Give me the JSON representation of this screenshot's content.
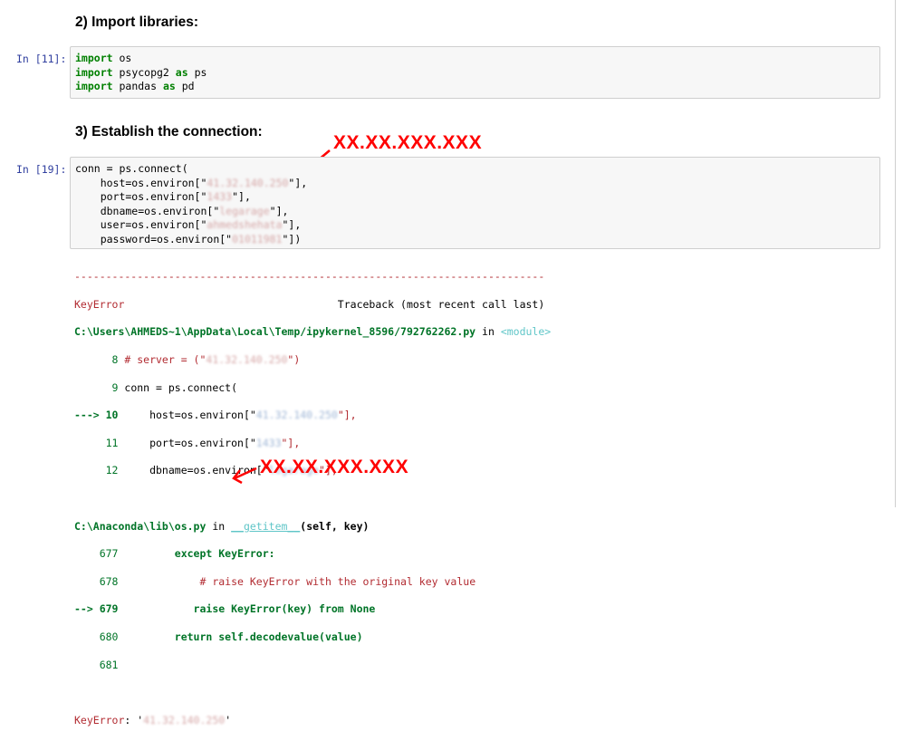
{
  "headings": {
    "import": "2) Import libraries:",
    "connect": "3) Establish the connection:"
  },
  "prompts": {
    "cell11": "In [11]:",
    "cell19": "In [19]:"
  },
  "cell11": {
    "l1_kw": "import",
    "l1_rest": " os",
    "l2_kw": "import",
    "l2_a": " psycopg2 ",
    "l2_kw2": "as",
    "l2_b": " ps",
    "l3_kw": "import",
    "l3_a": " pandas ",
    "l3_kw2": "as",
    "l3_b": " pd"
  },
  "cell19": {
    "l1": "conn = ps.connect(",
    "l2_a": "    host=os.environ[\"",
    "l2_v": "41.32.140.250",
    "l2_b": "\"],",
    "l3_a": "    port=os.environ[\"",
    "l3_v": "1433",
    "l3_b": "\"],",
    "l4_a": "    dbname=os.environ[\"",
    "l4_v": "legarage",
    "l4_b": "\"],",
    "l5_a": "    user=os.environ[\"",
    "l5_v": "ahmedshehata",
    "l5_b": "\"],",
    "l6_a": "    password=os.environ[\"",
    "l6_v": "01011981",
    "l6_b": "\"])"
  },
  "output": {
    "dashes": "---------------------------------------------------------------------------",
    "err_name": "KeyError",
    "traceback": "                                  Traceback (most recent call last)",
    "file1": "C:\\Users\\AHMEDS~1\\AppData\\Local\\Temp/ipykernel_8596/792762262.py",
    "in1": " in ",
    "module": "<module>",
    "l8_num": "      8 ",
    "l8_a": "# server = (\"",
    "l8_v": "41.32.140.250",
    "l8_b": "\")",
    "l9_num": "      9 ",
    "l9_a": "conn = ps.connect(",
    "l10_arrow": "---> 10",
    "l10_a": "     host=os.environ[\"",
    "l10_v": "41.32.140.250",
    "l10_b": "\"],",
    "l11_num": "     11",
    "l11_a": "     port=os.environ[\"",
    "l11_v": "1433",
    "l11_b": "\"],",
    "l12_num": "     12",
    "l12_a": "     dbname=os.environ[\"",
    "l12_v": "legarage",
    "l12_b": "\"],",
    "file2": "C:\\Anaconda\\lib\\os.py",
    "in2": " in ",
    "getitem": "__getitem__",
    "getitem_args": "(self, key)",
    "l677_num": "    677 ",
    "l677_a": "        except KeyError:",
    "l678_num": "    678 ",
    "l678_a": "            # raise KeyError with the original key value",
    "l679_arrow": "--> 679",
    "l679_a": "            raise KeyError(key) from None",
    "l680_num": "    680 ",
    "l680_a": "        return self.decodevalue(value)",
    "l681_num": "    681 ",
    "final_name": "KeyError",
    "final_sep": ": '",
    "final_v": "41.32.140.250",
    "final_end": "'"
  },
  "annotations": {
    "top": "XX.XX.XXX.XXX",
    "bottom": "XX.XX.XXX.XXX",
    "color": "#ff0000"
  }
}
